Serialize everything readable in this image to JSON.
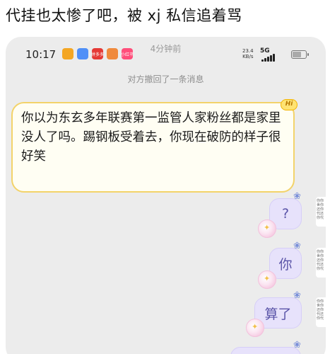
{
  "post": {
    "caption": "代挂也太惨了吧，被 xj 私信追着骂"
  },
  "status_bar": {
    "time": "10:17",
    "speed_value": "23.4",
    "speed_unit": "KB/s",
    "network": "5G",
    "app_icons": [
      {
        "name": "app-icon",
        "color": "#f4a623",
        "label": ""
      },
      {
        "name": "app-icon",
        "color": "#4f8ff7",
        "label": ""
      },
      {
        "name": "app-icon",
        "color": "#e53935",
        "label": "拼多多"
      },
      {
        "name": "app-icon",
        "color": "#f08a3c",
        "label": ""
      },
      {
        "name": "app-icon",
        "color": "#ff4e7a",
        "label": "小红书"
      }
    ]
  },
  "chat": {
    "timestamp": "4分钟前",
    "system_notice": "对方撤回了一条消息",
    "incoming_message": "你以为东玄多年联赛第一监管人家粉丝都是家里没人了吗。踢钢板受着去，你现在破防的样子很好笑",
    "incoming_badge": "Hi",
    "outgoing_messages": [
      {
        "text": "?"
      },
      {
        "text": "你"
      },
      {
        "text": "算了"
      }
    ],
    "side_snippet": "你你世你还你代还你代"
  },
  "colors": {
    "incoming_bubble_border": "#f3d36a",
    "outgoing_bubble": "#e7e2fb",
    "screen_background": "#ececec"
  }
}
